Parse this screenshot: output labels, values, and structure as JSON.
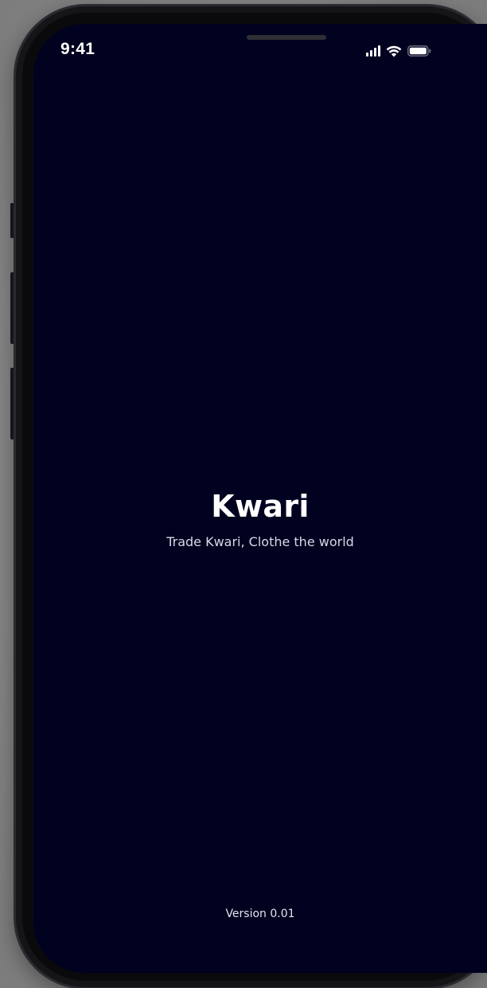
{
  "status_bar": {
    "time": "9:41",
    "icons": [
      "cellular-signal-icon",
      "wifi-icon",
      "battery-icon"
    ]
  },
  "splash": {
    "title": "Kwari",
    "tagline": "Trade Kwari, Clothe the world",
    "version": "Version 0.01"
  },
  "colors": {
    "screen_background": "#010120",
    "text_primary": "#ffffff",
    "text_secondary": "#d8d8e6"
  }
}
